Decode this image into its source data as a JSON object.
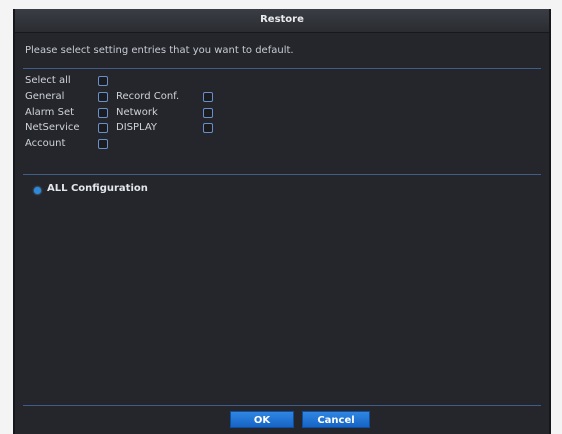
{
  "dialog": {
    "title": "Restore",
    "instruction": "Please select setting entries that you want to default.",
    "options": [
      {
        "key": "select_all",
        "label": "Select all",
        "checked": false
      },
      {
        "key": "general",
        "label": "General",
        "checked": false
      },
      {
        "key": "record_conf",
        "label": "Record Conf.",
        "checked": false
      },
      {
        "key": "alarm_set",
        "label": "Alarm Set",
        "checked": false
      },
      {
        "key": "network",
        "label": "Network",
        "checked": false
      },
      {
        "key": "netservice",
        "label": "NetService",
        "checked": false
      },
      {
        "key": "display",
        "label": "DISPLAY",
        "checked": false
      },
      {
        "key": "account",
        "label": "Account",
        "checked": false
      }
    ],
    "mode_label": "ALL Configuration",
    "buttons": {
      "ok": "OK",
      "cancel": "Cancel"
    }
  },
  "colors": {
    "panel": "#24262b",
    "divider": "#3f5d86",
    "button": "#1f74d6",
    "checkbox_border": "#6a8fc8"
  }
}
